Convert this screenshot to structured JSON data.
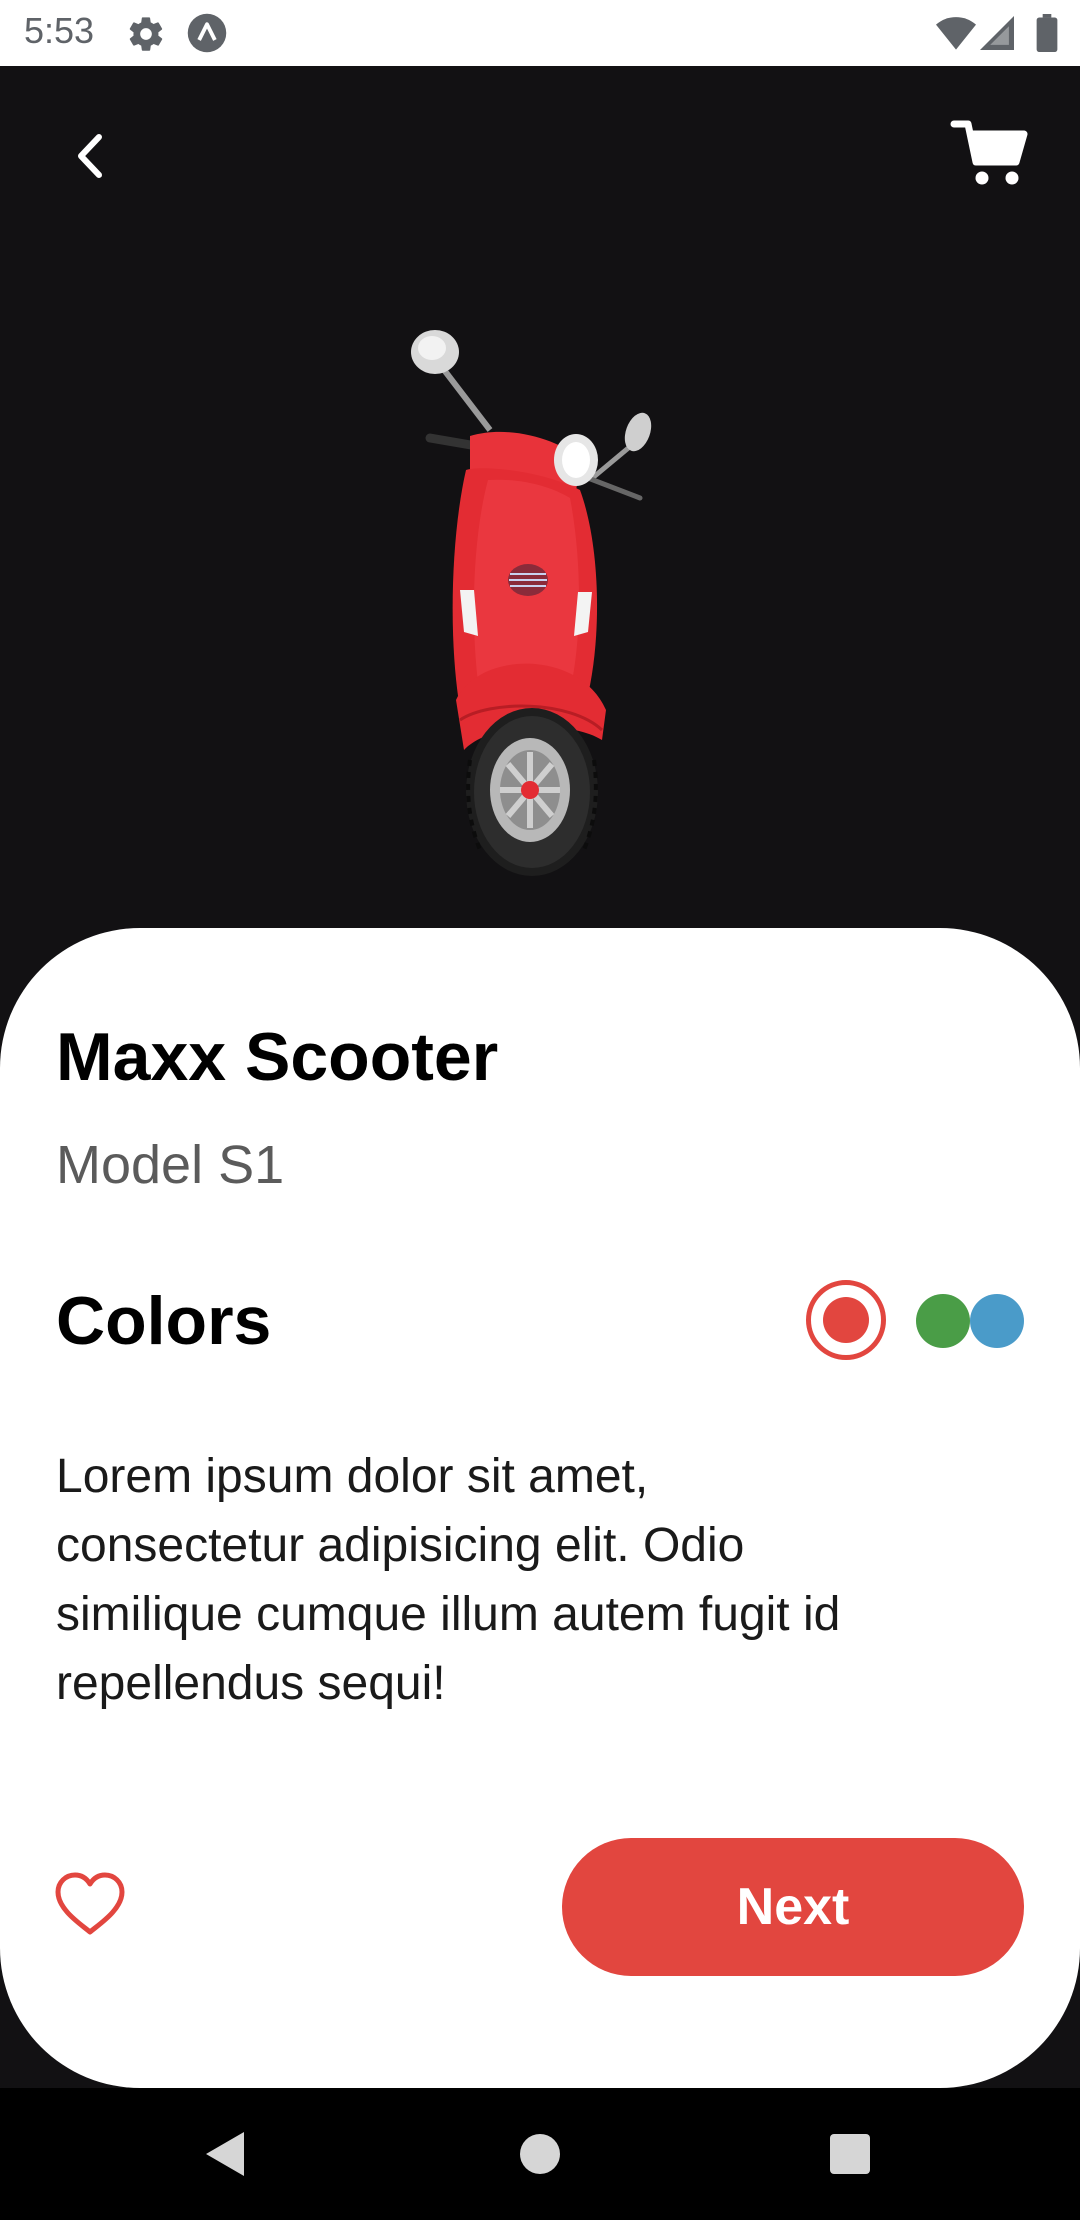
{
  "status_bar": {
    "time": "5:53",
    "icons": [
      "gear-icon",
      "app-notification-icon",
      "wifi-icon",
      "signal-icon",
      "battery-icon"
    ]
  },
  "header": {
    "back_icon": "chevron-left-icon",
    "cart_icon": "cart-icon"
  },
  "product": {
    "name": "Maxx Scooter",
    "model": "Model S1",
    "colors_label": "Colors",
    "colors": [
      {
        "hex": "#e2463f",
        "selected": true
      },
      {
        "hex": "#4a9d47",
        "selected": false
      },
      {
        "hex": "#4a9bc9",
        "selected": false
      }
    ],
    "description": "Lorem ipsum dolor sit amet, consectetur adipisicing elit. Odio similique cumque illum autem fugit id repellendus sequi!"
  },
  "actions": {
    "favorite_icon": "heart-outline-icon",
    "next_label": "Next"
  },
  "theme": {
    "accent": "#e2463f",
    "dark_background": "#121113",
    "card_background": "#ffffff"
  },
  "nav_bar": {
    "icons": [
      "nav-back-icon",
      "nav-home-icon",
      "nav-recents-icon"
    ]
  }
}
